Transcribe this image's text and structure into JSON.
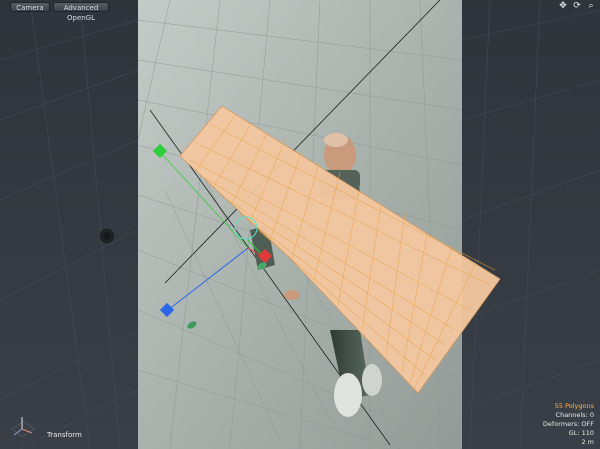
{
  "toolbar": {
    "camera_label": "Camera",
    "render_mode_label": "Advanced OpenGL"
  },
  "nav_icons": [
    "pan-icon",
    "rotate-icon",
    "zoom-icon"
  ],
  "status": {
    "polygons": "55 Polygons",
    "channels": "Channels: 0",
    "deformers": "Deformers: OFF",
    "gl": "GL: 110",
    "scale": "2 m"
  },
  "tool": {
    "active_tool": "Transform"
  },
  "colors": {
    "background_dark": "#2b2f35",
    "viewport_light": "#aeb5b2",
    "plane_fill": "#f2c7a0",
    "plane_grid": "#e8a44a",
    "handle_x": "#e23a3a",
    "handle_y": "#2ccf3a",
    "handle_z": "#2a66e6",
    "status_highlight": "#ffb347"
  }
}
